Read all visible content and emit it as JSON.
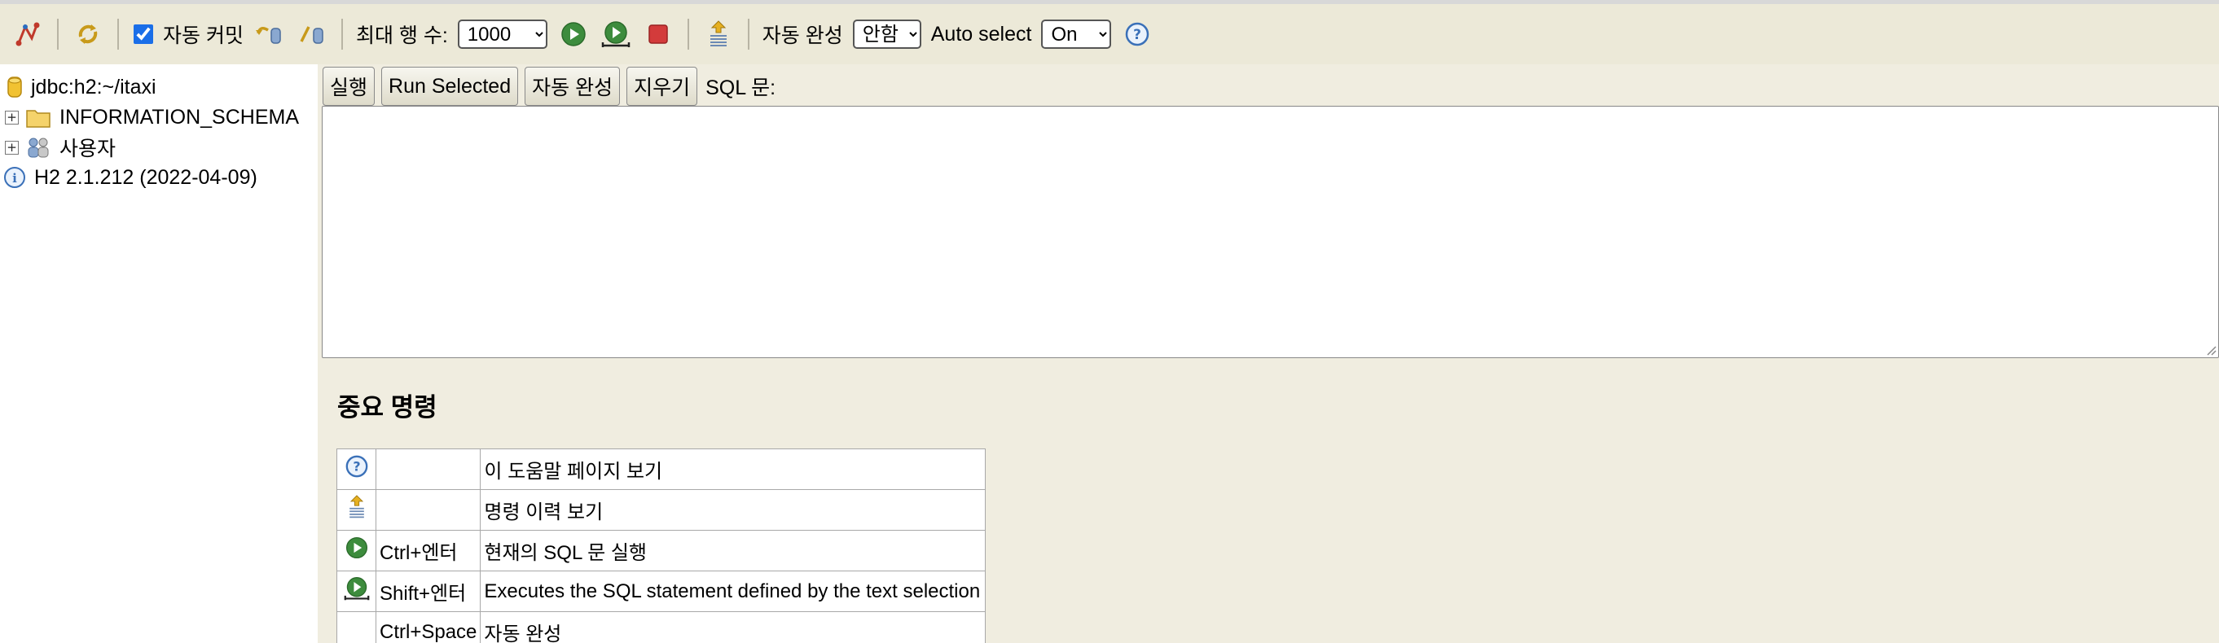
{
  "toolbar": {
    "autocommit_label": "자동 커밋",
    "autocommit_checked": true,
    "max_rows_label": "최대 행 수:",
    "max_rows_value": "1000",
    "autocomplete_label": "자동 완성",
    "autocomplete_value": "안함",
    "autoselect_label": "Auto select",
    "autoselect_value": "On",
    "icons": [
      "disconnect-icon",
      "refresh-icon",
      "rollback-icon",
      "commit-icon",
      "run-icon",
      "run-selected-icon",
      "stop-icon",
      "history-icon",
      "help-icon"
    ]
  },
  "tree": {
    "connection": "jdbc:h2:~/itaxi",
    "schema": "INFORMATION_SCHEMA",
    "users": "사용자",
    "version": "H2 2.1.212 (2022-04-09)"
  },
  "editor": {
    "buttons": {
      "run": "실행",
      "run_selected": "Run Selected",
      "autocomplete": "자동 완성",
      "clear": "지우기"
    },
    "sql_label": "SQL 문:",
    "value": ""
  },
  "help": {
    "heading": "중요 명령",
    "rows": [
      {
        "icon": "help-icon",
        "key": "",
        "desc": "이 도움말 페이지 보기"
      },
      {
        "icon": "history-icon",
        "key": "",
        "desc": "명령 이력 보기"
      },
      {
        "icon": "run-icon",
        "key": "Ctrl+엔터",
        "desc": "현재의 SQL 문 실행"
      },
      {
        "icon": "run-selected-icon",
        "key": "Shift+엔터",
        "desc": "Executes the SQL statement defined by the text selection"
      },
      {
        "icon": "",
        "key": "Ctrl+Space",
        "desc": "자동 완성"
      }
    ]
  },
  "colors": {
    "toolbar_bg": "#ece9d8",
    "panel_bg": "#f0ede0",
    "run_green": "#3d8c3d",
    "stop_red": "#d33b3b",
    "help_blue": "#3a70b8"
  }
}
